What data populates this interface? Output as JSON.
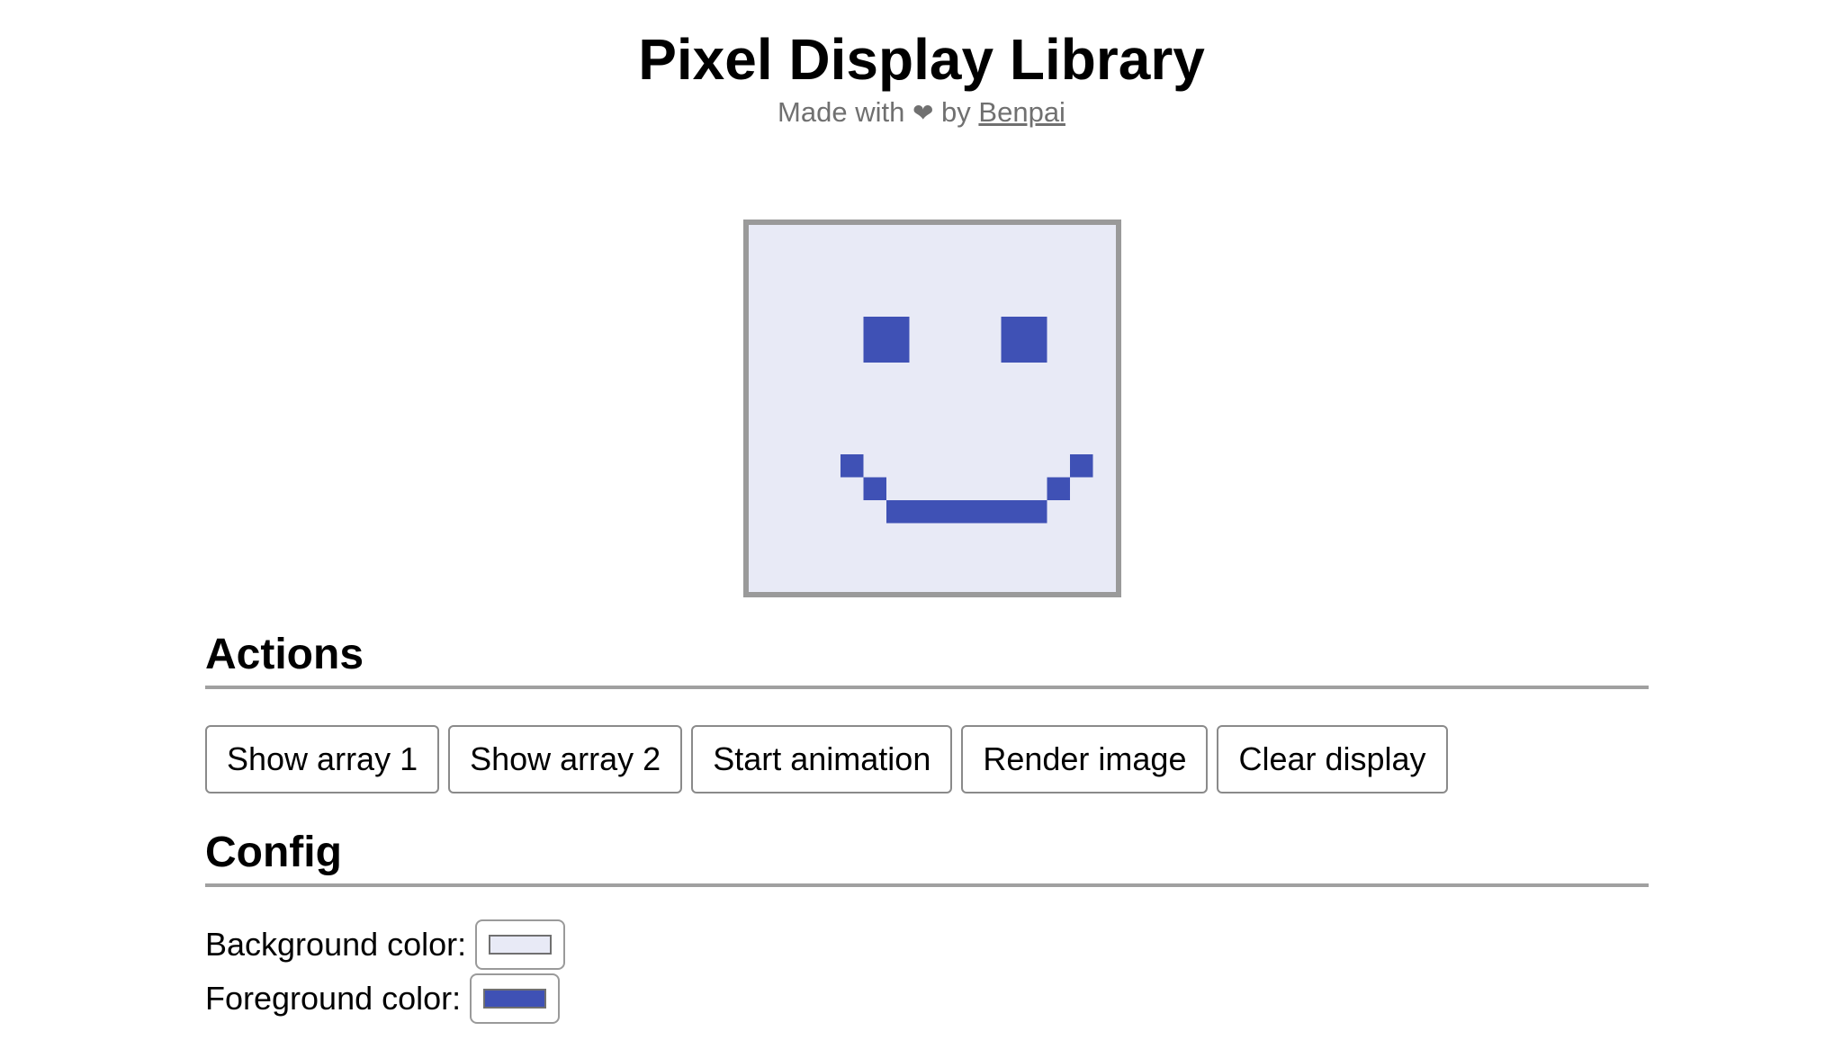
{
  "header": {
    "title": "Pixel Display Library",
    "subtitle_prefix": "Made with",
    "heart_icon": "heart-icon",
    "subtitle_by": "by",
    "author_link": "Benpai"
  },
  "display": {
    "grid_size": 16,
    "background_color": "#e8eaf6",
    "foreground_color": "#3f51b5",
    "lit_pixels": [
      [
        5,
        4
      ],
      [
        6,
        4
      ],
      [
        5,
        5
      ],
      [
        6,
        5
      ],
      [
        11,
        4
      ],
      [
        12,
        4
      ],
      [
        11,
        5
      ],
      [
        12,
        5
      ],
      [
        4,
        10
      ],
      [
        14,
        10
      ],
      [
        5,
        11
      ],
      [
        13,
        11
      ],
      [
        6,
        12
      ],
      [
        7,
        12
      ],
      [
        8,
        12
      ],
      [
        9,
        12
      ],
      [
        10,
        12
      ],
      [
        11,
        12
      ],
      [
        12,
        12
      ]
    ]
  },
  "actions": {
    "heading": "Actions",
    "buttons": [
      {
        "label": "Show array 1"
      },
      {
        "label": "Show array 2"
      },
      {
        "label": "Start animation"
      },
      {
        "label": "Render image"
      },
      {
        "label": "Clear display"
      }
    ]
  },
  "config": {
    "heading": "Config",
    "background_label": "Background color:",
    "background_value": "#e8eaf6",
    "foreground_label": "Foreground color:",
    "foreground_value": "#3f51b5"
  }
}
